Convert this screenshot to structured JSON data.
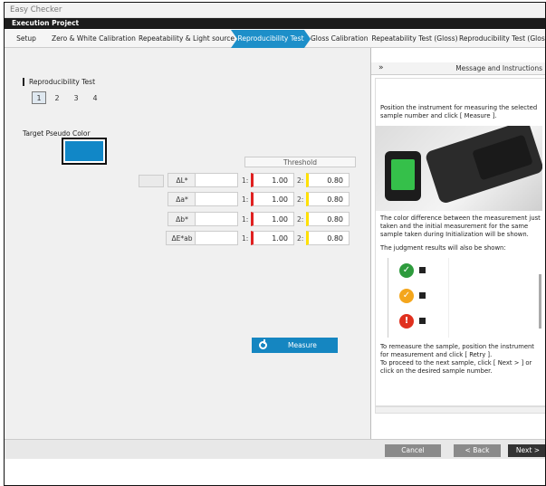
{
  "window": {
    "title": "Easy Checker",
    "project_label": "Execution Project"
  },
  "steps": [
    {
      "label": "Setup",
      "active": false
    },
    {
      "label": "Zero & White Calibration",
      "active": false
    },
    {
      "label": "Repeatability & Light source",
      "active": false
    },
    {
      "label": "Reproducibility Test",
      "active": true
    },
    {
      "label": "Gloss Calibration",
      "active": false
    },
    {
      "label": "Repeatability Test (Gloss)",
      "active": false
    },
    {
      "label": "Reproducibility Test (Gloss)",
      "active": false
    }
  ],
  "main": {
    "section_title": "Reproducibility Test",
    "samples": [
      "1",
      "2",
      "3",
      "4"
    ],
    "selected_sample": "1",
    "target_label": "Target Pseudo Color",
    "target_color": "#1187c7",
    "threshold_header": "Threshold",
    "rows": [
      {
        "label": "ΔL*",
        "idx1": "1:",
        "val1": "1.00",
        "idx2": "2:",
        "val2": "0.80"
      },
      {
        "label": "Δa*",
        "idx1": "1:",
        "val1": "1.00",
        "idx2": "2:",
        "val2": "0.80"
      },
      {
        "label": "Δb*",
        "idx1": "1:",
        "val1": "1.00",
        "idx2": "2:",
        "val2": "0.80"
      },
      {
        "label": "ΔE*ab",
        "idx1": "1:",
        "val1": "1.00",
        "idx2": "2:",
        "val2": "0.80"
      }
    ],
    "measure_label": "Measure"
  },
  "message": {
    "collapse_icon": "»",
    "title": "Message and Instructions",
    "p1": "Position the instrument for measuring the selected sample number and click [ Measure ].",
    "p2": "The color difference between the measurement just taken and the initial measurement for the same sample taken during Initialization will be shown.",
    "p3": "The judgment results will also be shown:",
    "p4": "To remeasure the sample, position the instrument for measurement and click [ Retry ].",
    "p5": "To proceed to the next sample, click [ Next > ] or click on the desired sample number."
  },
  "footer": {
    "cancel": "Cancel",
    "back": "< Back",
    "next": "Next >"
  },
  "colors": {
    "accent": "#1d8fc9",
    "threshold_red": "#e02020",
    "threshold_yellow": "#ffe000"
  }
}
